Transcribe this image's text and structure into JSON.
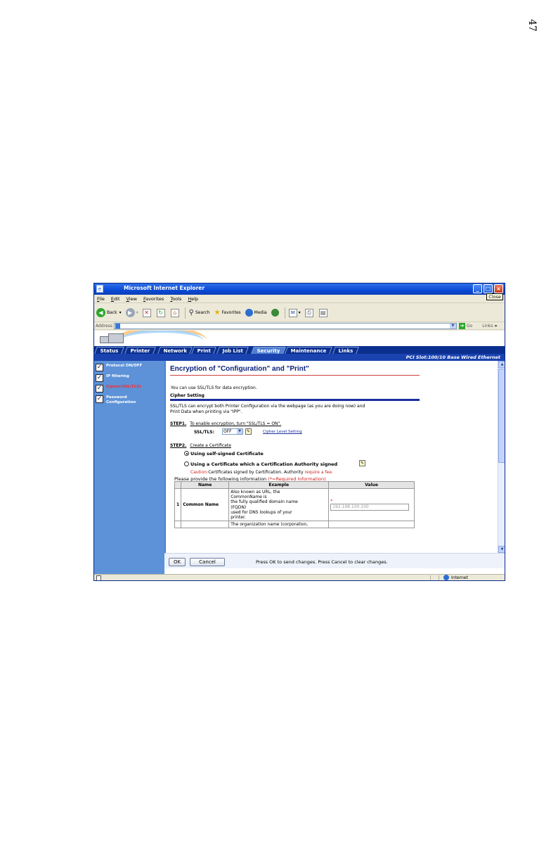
{
  "page": {
    "number": "47"
  },
  "window": {
    "title": "Microsoft Internet Explorer",
    "tooltip": "Close",
    "controls": {
      "minimize": "_",
      "maximize": "□",
      "close": "×"
    }
  },
  "menu": [
    "File",
    "Edit",
    "View",
    "Favorites",
    "Tools",
    "Help"
  ],
  "toolbar": {
    "back": "Back",
    "search": "Search",
    "favorites": "Favorites",
    "media": "Media"
  },
  "address": {
    "label": "Address",
    "go": "Go",
    "links": "Links"
  },
  "tabs": [
    "Status",
    "Printer",
    "Network",
    "Print",
    "Job List",
    "Security",
    "Maintenance",
    "Links"
  ],
  "active_tab": "Security",
  "infobar": "PCI Slot:100/10 Base Wired Ethernet",
  "sidebar": {
    "items": [
      {
        "label": "Protocol ON/OFF",
        "active": false
      },
      {
        "label": "IP filtering",
        "active": false
      },
      {
        "label": "Cipher(SSL/TLS)",
        "active": true
      },
      {
        "label": "Password Configuration",
        "active": false
      }
    ]
  },
  "main": {
    "title": "Encryption of \"Configuration\" and \"Print\"",
    "intro": "You can use SSL/TLS for data encryption.",
    "section": "Cipher Setting",
    "desc1": "SSL/TLS can encrypt both Printer Configuration via the webpage (as you are doing now) and",
    "desc2": "Print Data when printing via \"IPP\".",
    "step1_label": "STEP1.",
    "step1_text": "To enable encryption, turn \"SSL/TLS = ON\".",
    "ssltls_label": "SSL/TLS:",
    "ssltls_value": "OFF",
    "cipher_link": "Cipher Level Setting",
    "step2_label": "STEP2.",
    "step2_text": "Create a Certificate",
    "option1": "Using self-signed Certificate",
    "option2": "Using a Certificate which a Certification Authority signed",
    "caution_label": "Caution:",
    "caution_text": "Certificates signed by Certification. Authority",
    "caution_fee": "require a fee.",
    "provide_text": "Please provide the following information",
    "required_note": "(*=Required Information)",
    "table": {
      "headers": [
        "Name",
        "Example",
        "Value"
      ],
      "rows": [
        {
          "num": "1",
          "name": "Common Name",
          "example": [
            "Also known as URL, the",
            "CommonName is",
            "the fully qualified domain name",
            "(FQDN)",
            "used for DNS lookups of your",
            "printer."
          ],
          "required": "*",
          "value": "192.168.100.100"
        },
        {
          "num": "",
          "name": "",
          "example": [
            "The organization name (corporation,"
          ],
          "required": "",
          "value": ""
        }
      ]
    }
  },
  "bottombar": {
    "ok": "OK",
    "cancel": "Cancel",
    "message": "Press OK to send changes. Press Cancel to clear changes."
  },
  "status": {
    "zone": "Internet"
  }
}
